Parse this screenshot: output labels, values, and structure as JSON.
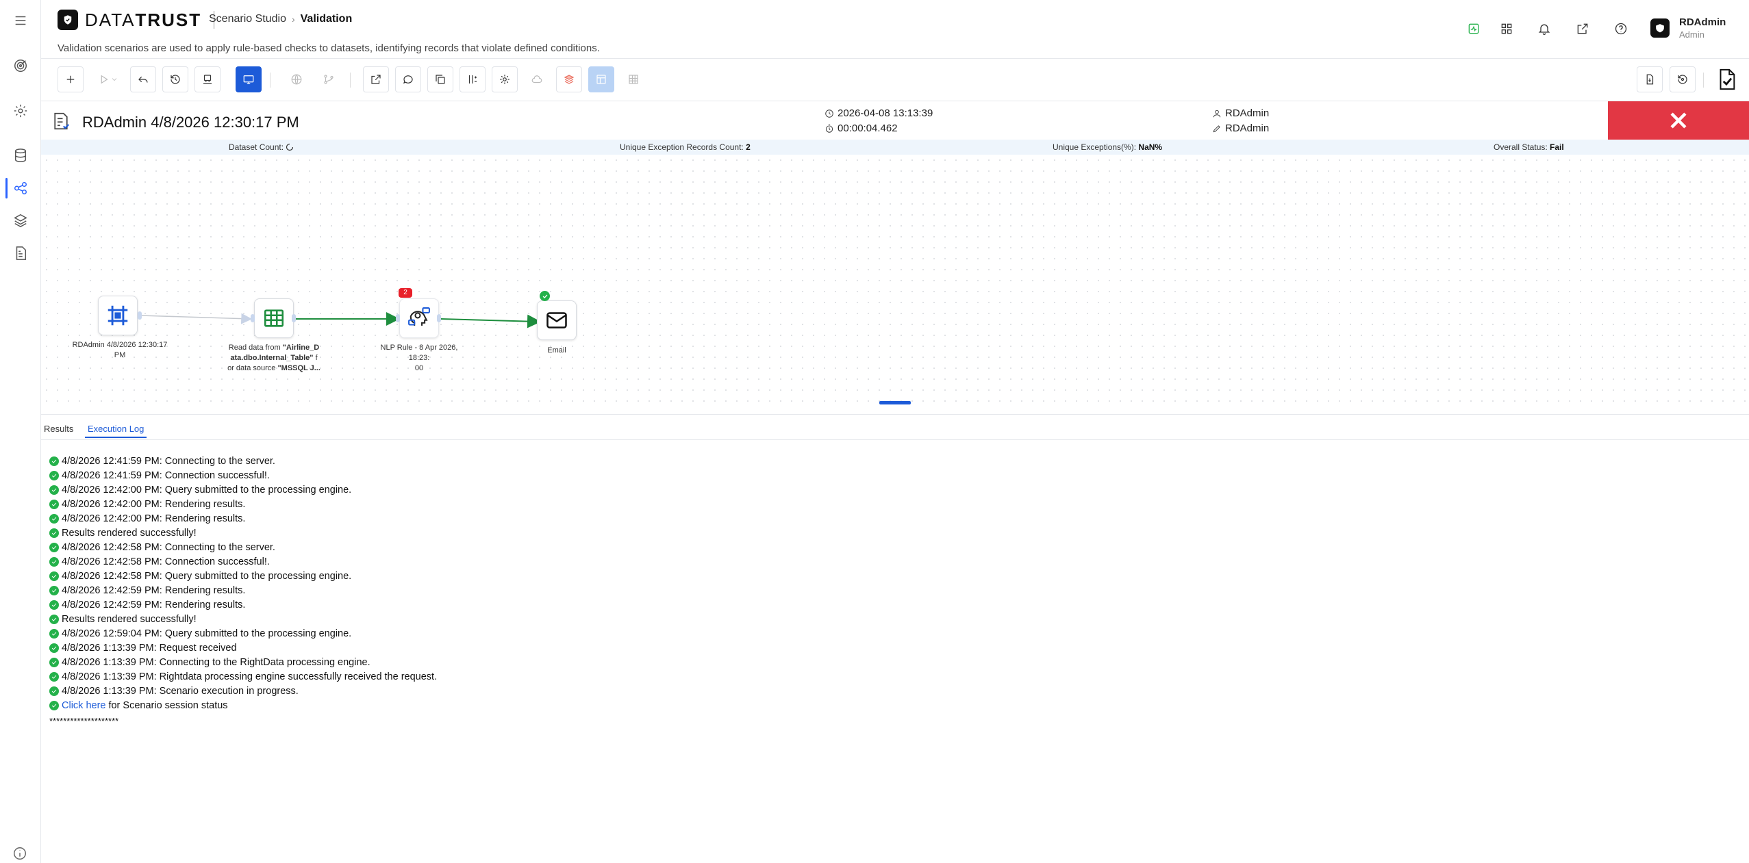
{
  "header": {
    "brand_light": "DATA",
    "brand_bold": "TRUST",
    "breadcrumb": [
      "Scenario Studio",
      "Validation"
    ],
    "subtitle": "Validation scenarios are used to apply rule-based checks to datasets, identifying records that violate defined conditions.",
    "user_name": "RDAdmin",
    "user_role": "Admin"
  },
  "run": {
    "title": "RDAdmin 4/8/2026 12:30:17 PM",
    "datetime": "2026-04-08 13:13:39",
    "duration": "00:00:04.462",
    "created_by": "RDAdmin",
    "edited_by": "RDAdmin",
    "status_color": "#e23744"
  },
  "stats": {
    "dataset_label": "Dataset Count:",
    "unique_label": "Unique Exception Records Count:",
    "unique_value": "2",
    "pct_label": "Unique Exceptions(%):",
    "pct_value": "NaN%",
    "status_label": "Overall Status:",
    "status_value": "Fail"
  },
  "nodes": {
    "scenario_label_1": "RDAdmin 4/8/2026 12:30:17",
    "scenario_label_2": "PM",
    "read_l1_pre": "Read data from ",
    "read_l1_bold": "\"Airline_D",
    "read_l2_bold": "ata.dbo.Internal_Table\"",
    "read_l2_post": " f",
    "read_l3_pre": "or data source ",
    "read_l3_bold": "\"MSSQL J...",
    "nlp_label_1": "NLP Rule - 8 Apr 2026, 18:23:",
    "nlp_label_2": "00",
    "nlp_badge": "2",
    "email_label": "Email"
  },
  "tabs": {
    "results": "Results",
    "log": "Execution Log"
  },
  "log": [
    "4/8/2026 12:41:59 PM: Connecting to the server.",
    "4/8/2026 12:41:59 PM: Connection successful!.",
    "4/8/2026 12:42:00 PM: Query submitted to the processing engine.",
    "4/8/2026 12:42:00 PM: Rendering results.",
    "4/8/2026 12:42:00 PM: Rendering results.",
    "Results rendered successfully!",
    "4/8/2026 12:42:58 PM: Connecting to the server.",
    "4/8/2026 12:42:58 PM: Connection successful!.",
    "4/8/2026 12:42:58 PM: Query submitted to the processing engine.",
    "4/8/2026 12:42:59 PM: Rendering results.",
    "4/8/2026 12:42:59 PM: Rendering results.",
    "Results rendered successfully!",
    "4/8/2026 12:59:04 PM: Query submitted to the processing engine.",
    "4/8/2026 1:13:39 PM: Request received",
    "4/8/2026 1:13:39 PM: Connecting to the RightData processing engine.",
    "4/8/2026 1:13:39 PM: Rightdata processing engine successfully received the request.",
    "4/8/2026 1:13:39 PM: Scenario execution in progress."
  ],
  "log_link": "Click here",
  "log_link_suffix": "for Scenario session status",
  "log_stars": "********************"
}
